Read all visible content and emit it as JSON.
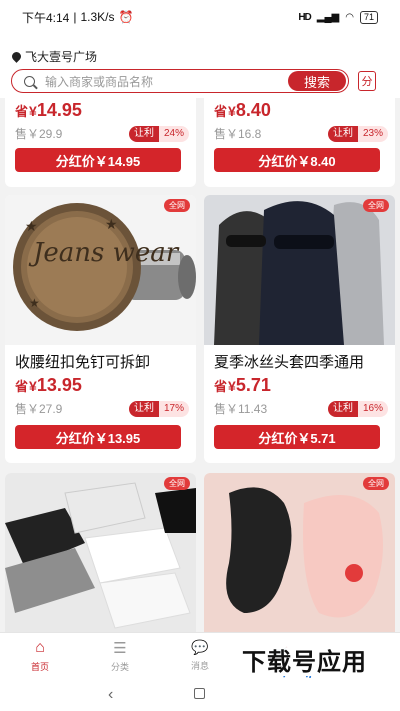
{
  "status_bar": {
    "time": "下午4:14",
    "speed": "1.3K/s",
    "signal": "HD",
    "battery": "71"
  },
  "header": {
    "location": "飞大壹号广场",
    "search_placeholder": "输入商家或商品名称",
    "search_button": "搜索",
    "category_button": "分"
  },
  "products": [
    {
      "name": "",
      "save_label": "省",
      "currency": "¥",
      "price": "14.95",
      "original": "售￥29.9",
      "tag_label": "让利",
      "discount": "24%",
      "share_label": "分红价￥14.95",
      "badge": ""
    },
    {
      "name": "",
      "save_label": "省",
      "currency": "¥",
      "price": "8.40",
      "original": "售￥16.8",
      "tag_label": "让利",
      "discount": "23%",
      "share_label": "分红价￥8.40",
      "badge": ""
    },
    {
      "name": "收腰纽扣免钉可拆卸",
      "save_label": "省",
      "currency": "¥",
      "price": "13.95",
      "original": "售￥27.9",
      "tag_label": "让利",
      "discount": "17%",
      "share_label": "分红价￥13.95",
      "badge": "全网"
    },
    {
      "name": "夏季冰丝头套四季通用",
      "save_label": "省",
      "currency": "¥",
      "price": "5.71",
      "original": "售￥11.43",
      "tag_label": "让利",
      "discount": "16%",
      "share_label": "分红价￥5.71",
      "badge": "全网"
    },
    {
      "name": "",
      "badge": "全网"
    },
    {
      "name": "",
      "badge": "全网"
    }
  ],
  "button_image_text": {
    "jeans": "Jeans wear"
  },
  "tabs": [
    {
      "label": "首页",
      "icon": "home-icon",
      "active": true
    },
    {
      "label": "分类",
      "icon": "list-icon",
      "active": false
    },
    {
      "label": "消息",
      "icon": "message-icon",
      "active": false
    },
    {
      "label": "",
      "icon": "cart-icon",
      "active": false
    },
    {
      "label": "",
      "icon": "user-icon",
      "active": false
    }
  ],
  "watermark": {
    "title": "下载号应用",
    "url": "www.xiazaihao.com"
  },
  "colors": {
    "accent": "#c8262c"
  }
}
